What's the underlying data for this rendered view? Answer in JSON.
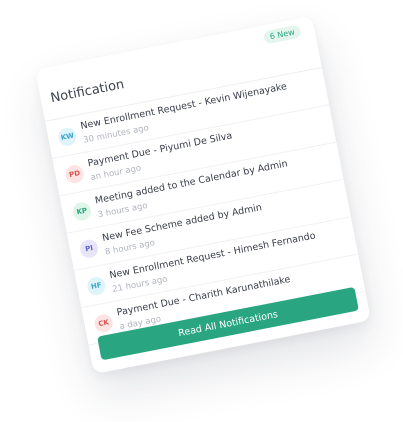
{
  "panel": {
    "title": "Notification",
    "new_badge": "6 New",
    "button_label": "Read All Notifications"
  },
  "notifications": [
    {
      "initials": "KW",
      "message": "New Enrollment Request - Kevin Wijenayake",
      "time": "30 minutes ago",
      "bg": "#dff3fb",
      "fg": "#3aa6cc"
    },
    {
      "initials": "PD",
      "message": "Payment Due - Piyumi De Silva",
      "time": "an hour ago",
      "bg": "#fde4e4",
      "fg": "#d9534f"
    },
    {
      "initials": "KP",
      "message": "Meeting added to the Calendar by Admin",
      "time": "3 hours ago",
      "bg": "#e0f5ea",
      "fg": "#2aa582"
    },
    {
      "initials": "PI",
      "message": "New Fee Scheme added by Admin",
      "time": "8 hours ago",
      "bg": "#e6e6f8",
      "fg": "#5b5fc7"
    },
    {
      "initials": "HF",
      "message": "New Enrollment Request - Himesh Fernando",
      "time": "21 hours ago",
      "bg": "#dff3fb",
      "fg": "#3aa6cc"
    },
    {
      "initials": "CK",
      "message": "Payment Due - Charith Karunathilake",
      "time": "a day ago",
      "bg": "#fde4e4",
      "fg": "#d9534f"
    }
  ]
}
